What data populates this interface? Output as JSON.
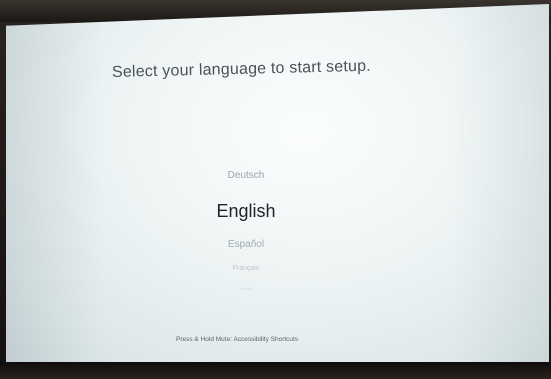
{
  "setup": {
    "title": "Select your language to start setup.",
    "languages": [
      {
        "label": "Deutsch"
      },
      {
        "label": "English",
        "selected": true
      },
      {
        "label": "Español"
      },
      {
        "label": "Français"
      },
      {
        "label": "Italiano"
      }
    ],
    "footer_hint": "Press & Hold Mute: Accessibility Shortcuts"
  },
  "colors": {
    "screen_background": "#eef4f4",
    "selected_text": "#1e2428",
    "unselected_text": "#9aa3a8",
    "bezel": "#1a1614"
  }
}
